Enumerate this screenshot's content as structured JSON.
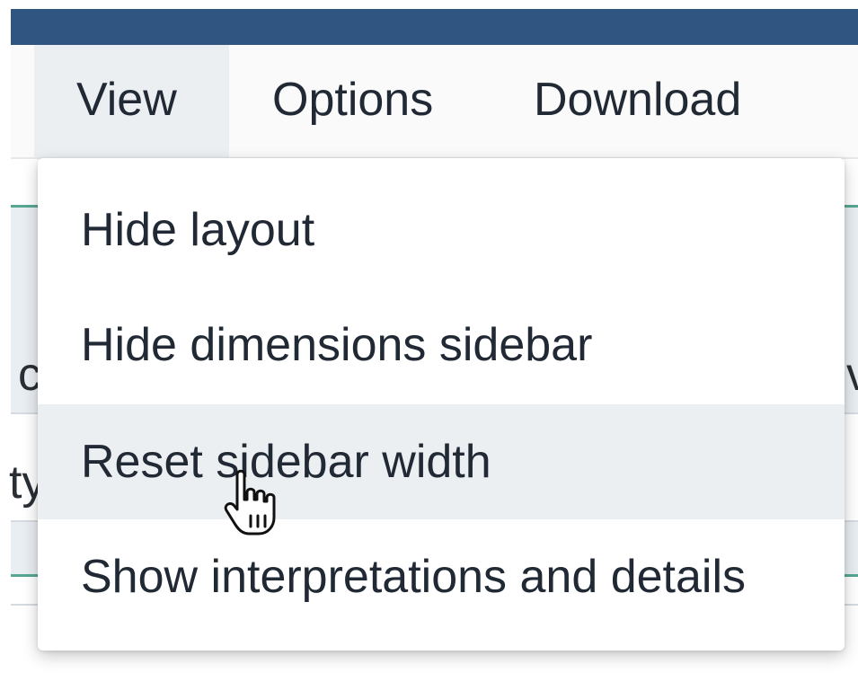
{
  "menubar": {
    "items": [
      {
        "label": "View",
        "active": true
      },
      {
        "label": "Options",
        "active": false
      },
      {
        "label": "Download",
        "active": false
      }
    ]
  },
  "view_menu": {
    "items": [
      {
        "label": "Hide layout"
      },
      {
        "label": "Hide dimensions sidebar"
      },
      {
        "label": "Reset sidebar width",
        "hovered": true
      },
      {
        "label": "Show interpretations and details"
      }
    ]
  },
  "background": {
    "fragments": [
      "c",
      "ty",
      "v"
    ]
  },
  "cursor": {
    "icon": "hand-pointer-icon"
  },
  "colors": {
    "header": "#2f5580",
    "accent_line": "#57a793",
    "hover_bg": "#eceff2",
    "text": "#212934"
  }
}
